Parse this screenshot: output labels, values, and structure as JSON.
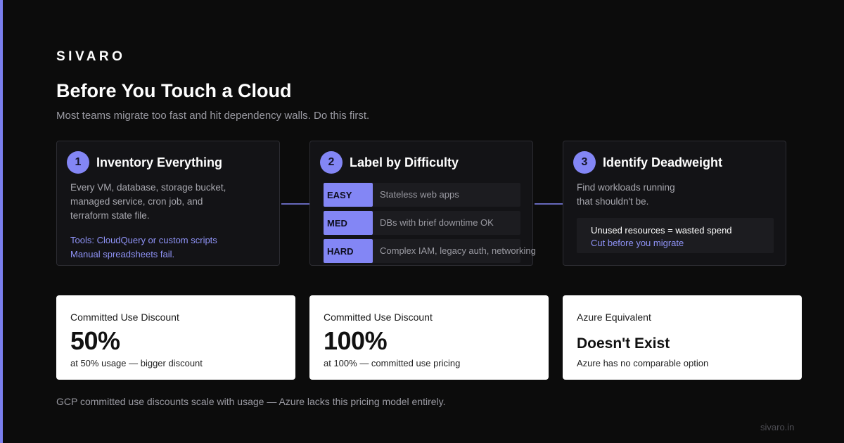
{
  "brand": "SIVARO",
  "title": "Before You Touch a Cloud",
  "subtitle": "Most teams migrate too fast and hit dependency walls. Do this first.",
  "steps": [
    {
      "number": "1",
      "title": "Inventory Everything",
      "desc": [
        "Every VM, database, storage bucket,",
        "managed service, cron job, and",
        "terraform state file."
      ],
      "note": [
        "Tools: CloudQuery or custom scripts",
        "Manual spreadsheets fail."
      ]
    },
    {
      "number": "2",
      "title": "Label by Difficulty",
      "rows": [
        {
          "badge": "EASY",
          "label": "Stateless web apps"
        },
        {
          "badge": "MED",
          "label": "DBs with brief downtime OK"
        },
        {
          "badge": "HARD",
          "label": "Complex IAM, legacy auth, networking"
        }
      ]
    },
    {
      "number": "3",
      "title": "Identify Deadweight",
      "desc": [
        "Find workloads running",
        "that shouldn't be."
      ],
      "box": {
        "line1": "Unused resources = wasted spend",
        "line2": "Cut before you migrate"
      }
    }
  ],
  "stats": [
    {
      "label": "Committed Use Discount",
      "value": "50%",
      "caption": "at 50% usage — bigger discount"
    },
    {
      "label": "Committed Use Discount",
      "value": "100%",
      "caption": "at 100% — committed use pricing"
    },
    {
      "label": "Azure Equivalent",
      "value": "Doesn't Exist",
      "caption": "Azure has no comparable option"
    }
  ],
  "footnote": "GCP committed use discounts scale with usage — Azure lacks this pricing model entirely.",
  "site": "sivaro.in",
  "colors": {
    "accent": "#8386f5",
    "background": "#0c0c0c",
    "card": "#131316",
    "stat_card": "#ffffff"
  },
  "icons": {
    "arrow": "arrow-right-icon"
  }
}
